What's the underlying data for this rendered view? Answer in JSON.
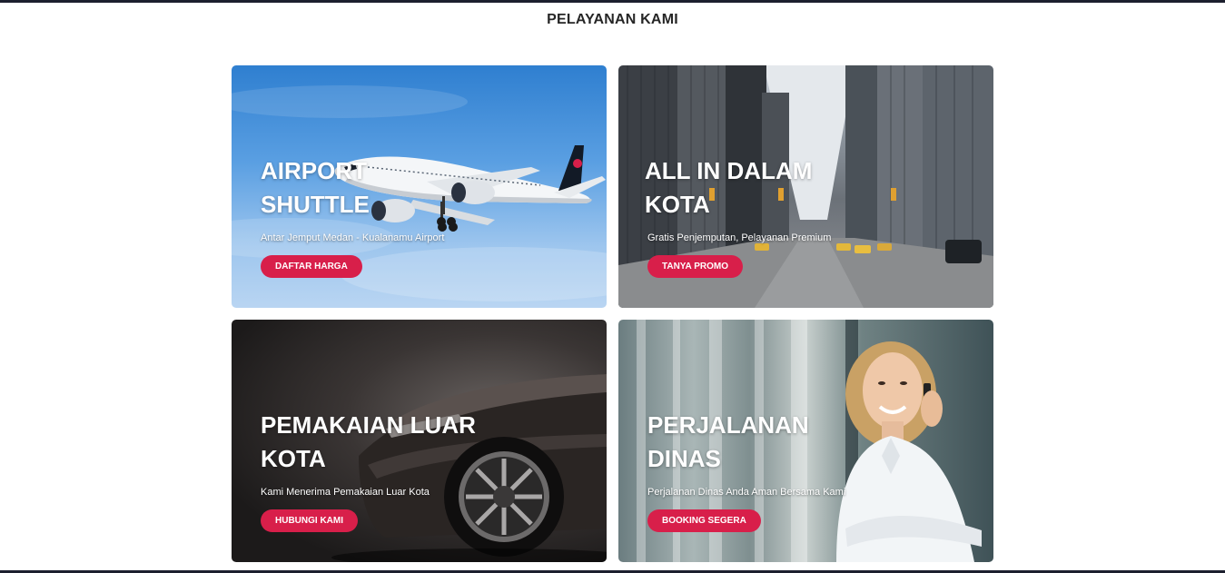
{
  "section": {
    "title": "PELAYANAN KAMI"
  },
  "cards": [
    {
      "title_line1": "AIRPORT",
      "title_line2": "SHUTTLE",
      "subtitle": "Antar Jemput Medan - Kualanamu Airport",
      "button": "DAFTAR HARGA",
      "image": "airplane-image"
    },
    {
      "title_line1": "ALL IN DALAM",
      "title_line2": "KOTA",
      "subtitle": "Gratis Penjemputan, Pelayanan Premium",
      "button": "TANYA PROMO",
      "image": "city-street-image"
    },
    {
      "title_line1": "PEMAKAIAN LUAR",
      "title_line2": "KOTA",
      "subtitle": "Kami Menerima Pemakaian Luar Kota",
      "button": "HUBUNGI KAMI",
      "image": "car-image"
    },
    {
      "title_line1": "PERJALANAN",
      "title_line2": "DINAS",
      "subtitle": "Perjalanan Dinas Anda Aman Bersama Kami",
      "button": "BOOKING SEGERA",
      "image": "business-woman-image"
    }
  ],
  "colors": {
    "accent": "#d81f4a",
    "rule": "#1c1f2e"
  }
}
